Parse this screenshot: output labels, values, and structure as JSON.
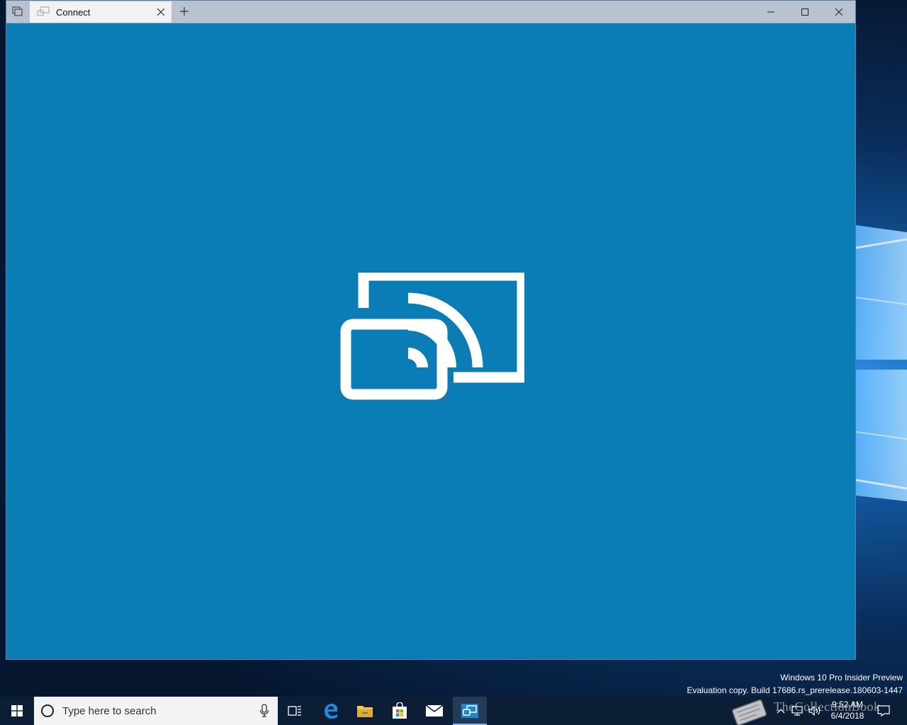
{
  "window": {
    "tab_title": "Connect",
    "tab_icon": "connect-app-icon",
    "caption_buttons": [
      "minimize",
      "maximize",
      "close"
    ],
    "background_color": "#0a7db6"
  },
  "content": {
    "hero_icon": "project-to-screen-icon"
  },
  "desktop": {
    "watermark_line1": "Windows 10 Pro Insider Preview",
    "watermark_line2": "Evaluation copy. Build 17686.rs_prerelease.180603-1447"
  },
  "taskbar": {
    "search_placeholder": "Type here to search",
    "apps": [
      "task-view",
      "edge",
      "file-explorer",
      "store",
      "mail",
      "connect"
    ],
    "clock_time": "9:52 AM",
    "clock_date": "6/4/2018",
    "brand_text": "TheCollectionBook"
  }
}
